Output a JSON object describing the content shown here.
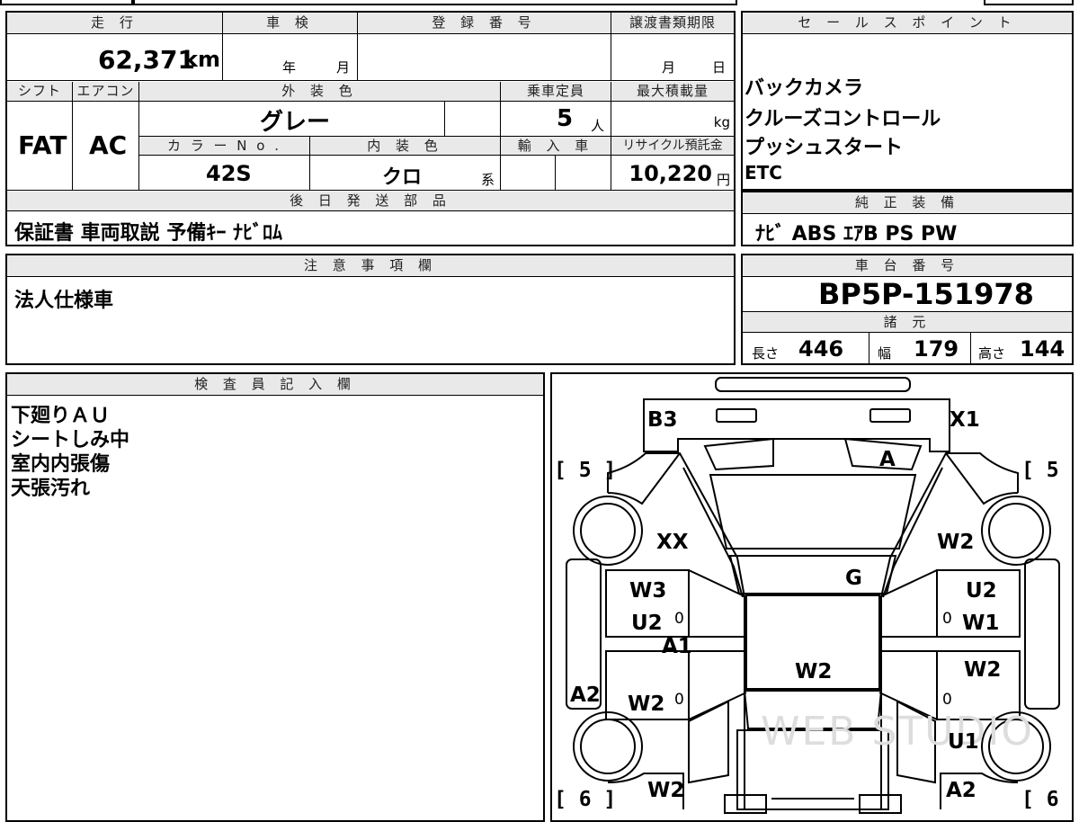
{
  "top": {
    "mileage_label": "走 行",
    "mileage_value": "62,371",
    "mileage_unit": "km",
    "inspection_label": "車 検",
    "year_label": "年",
    "month_label": "月",
    "registration_label": "登 録 番 号",
    "transfer_label": "譲渡書類期限",
    "transfer_month": "月",
    "transfer_day": "日",
    "shift_label": "シフト",
    "shift_value": "FAT",
    "ac_label": "エアコン",
    "ac_value": "AC",
    "exterior_color_label": "外 装 色",
    "exterior_color_value": "グレー",
    "capacity_label": "乗車定員",
    "capacity_value": "5",
    "capacity_unit": "人",
    "max_load_label": "最大積載量",
    "max_load_unit": "kg",
    "color_no_label": "カ ラ ー N o .",
    "color_no_value": "42S",
    "interior_color_label": "内 装 色",
    "interior_color_value": "クロ",
    "interior_color_suffix": "系",
    "import_label": "輸 入 車",
    "recycle_label": "リサイクル預託金",
    "recycle_value": "10,220",
    "recycle_unit": "円",
    "later_parts_label": "後 日 発 送 部 品",
    "later_parts_value": "保証書 車両取説 予備ｷｰ ﾅﾋﾞﾛﾑ"
  },
  "sales_points": {
    "label": "セ ー ル ス ポ イ ン ト",
    "items": [
      "バックカメラ",
      "クルーズコントロール",
      "プッシュスタート",
      "ETC"
    ]
  },
  "genuine_equipment": {
    "label": "純 正 装 備",
    "value": "ﾅﾋﾞ ABS ｴｱB PS PW"
  },
  "notes": {
    "label": "注 意 事 項 欄",
    "value": "法人仕様車"
  },
  "chassis": {
    "label": "車 台 番 号",
    "value": "BP5P-151978",
    "specs_label": "諸 元",
    "length_label": "長さ",
    "length_value": "446",
    "width_label": "幅",
    "width_value": "179",
    "height_label": "高さ",
    "height_value": "144"
  },
  "inspector": {
    "label": "検 査 員 記 入 欄",
    "lines": [
      "下廻りＡＵ",
      "シートしみ中",
      "室内内張傷",
      "天張汚れ"
    ]
  },
  "diagram": {
    "watermark": "WEB STUDIO",
    "tire_front_left": "5",
    "tire_front_right": "5",
    "tire_rear_left": "6",
    "tire_rear_right": "6",
    "marks": {
      "front_left_corner": "B3",
      "front_right_corner": "X1",
      "windshield_right": "A",
      "front_left_fender": "XX",
      "front_right_fender": "W2",
      "roof_front": "G",
      "left_front_door_1": "W3",
      "left_front_door_2": "U2",
      "left_front_door_zero": "0",
      "left_pillar": "A1",
      "left_rear_door": "W2",
      "left_rear_door_zero": "0",
      "left_sill": "A2",
      "roof_center": "W2",
      "right_front_door_1": "U2",
      "right_front_door_2": "W1",
      "right_front_door_zero": "0",
      "right_rear_door": "W2",
      "right_rear_door_zero": "0",
      "right_rear_fender": "U1",
      "left_rear_quarter": "W2",
      "right_rear_quarter": "A2"
    }
  }
}
